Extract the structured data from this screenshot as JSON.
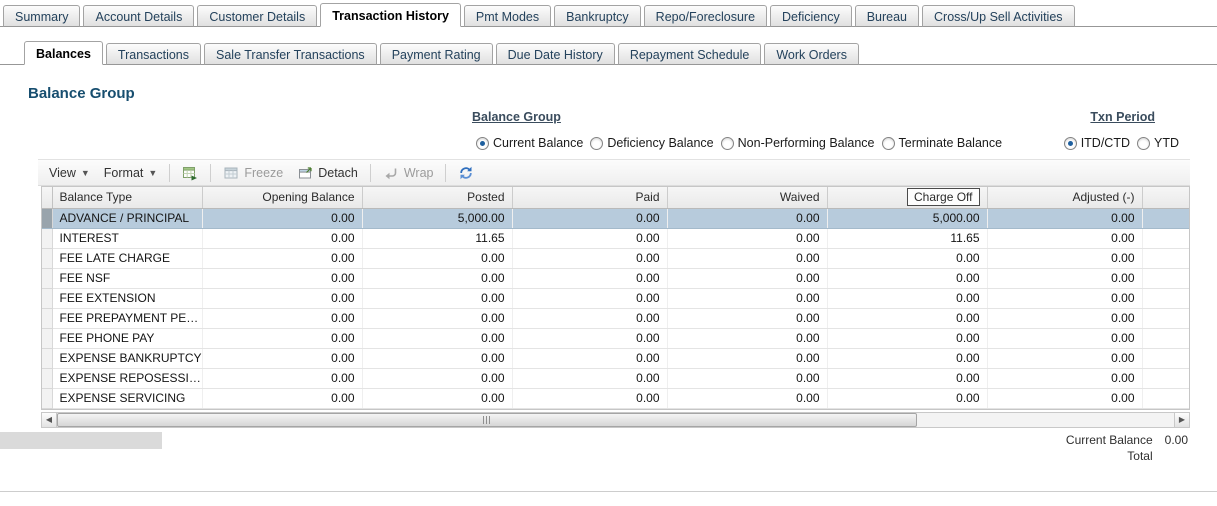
{
  "top_tabs": [
    {
      "label": "Summary",
      "active": false
    },
    {
      "label": "Account Details",
      "active": false
    },
    {
      "label": "Customer Details",
      "active": false
    },
    {
      "label": "Transaction History",
      "active": true
    },
    {
      "label": "Pmt Modes",
      "active": false
    },
    {
      "label": "Bankruptcy",
      "active": false
    },
    {
      "label": "Repo/Foreclosure",
      "active": false
    },
    {
      "label": "Deficiency",
      "active": false
    },
    {
      "label": "Bureau",
      "active": false
    },
    {
      "label": "Cross/Up Sell Activities",
      "active": false
    }
  ],
  "sub_tabs": [
    {
      "label": "Balances",
      "active": true
    },
    {
      "label": "Transactions",
      "active": false
    },
    {
      "label": "Sale Transfer Transactions",
      "active": false
    },
    {
      "label": "Payment Rating",
      "active": false
    },
    {
      "label": "Due Date History",
      "active": false
    },
    {
      "label": "Repayment Schedule",
      "active": false
    },
    {
      "label": "Work Orders",
      "active": false
    }
  ],
  "section": {
    "title": "Balance Group"
  },
  "filters": {
    "balance_group_label": "Balance Group",
    "txn_period_label": "Txn Period",
    "balance_group_options": [
      {
        "label": "Current Balance",
        "selected": true
      },
      {
        "label": "Deficiency Balance",
        "selected": false
      },
      {
        "label": "Non-Performing Balance",
        "selected": false
      },
      {
        "label": "Terminate Balance",
        "selected": false
      }
    ],
    "txn_period_options": [
      {
        "label": "ITD/CTD",
        "selected": true
      },
      {
        "label": "YTD",
        "selected": false
      }
    ]
  },
  "toolbar": {
    "view_label": "View",
    "format_label": "Format",
    "freeze_label": "Freeze",
    "detach_label": "Detach",
    "wrap_label": "Wrap",
    "icons": [
      "export-to-excel-icon",
      "freeze-icon",
      "detach-icon",
      "wrap-icon",
      "refresh-icon"
    ]
  },
  "table": {
    "columns": [
      "Balance Type",
      "Opening Balance",
      "Posted",
      "Paid",
      "Waived",
      "Charge Off",
      "Adjusted (-)"
    ],
    "focused_column": "Charge Off",
    "rows": [
      {
        "selected": true,
        "cells": [
          "ADVANCE / PRINCIPAL",
          "0.00",
          "5,000.00",
          "0.00",
          "0.00",
          "5,000.00",
          "0.00"
        ]
      },
      {
        "selected": false,
        "cells": [
          "INTEREST",
          "0.00",
          "11.65",
          "0.00",
          "0.00",
          "11.65",
          "0.00"
        ]
      },
      {
        "selected": false,
        "cells": [
          "FEE LATE CHARGE",
          "0.00",
          "0.00",
          "0.00",
          "0.00",
          "0.00",
          "0.00"
        ]
      },
      {
        "selected": false,
        "cells": [
          "FEE NSF",
          "0.00",
          "0.00",
          "0.00",
          "0.00",
          "0.00",
          "0.00"
        ]
      },
      {
        "selected": false,
        "cells": [
          "FEE EXTENSION",
          "0.00",
          "0.00",
          "0.00",
          "0.00",
          "0.00",
          "0.00"
        ]
      },
      {
        "selected": false,
        "cells": [
          "FEE PREPAYMENT PE…",
          "0.00",
          "0.00",
          "0.00",
          "0.00",
          "0.00",
          "0.00"
        ]
      },
      {
        "selected": false,
        "cells": [
          "FEE PHONE PAY",
          "0.00",
          "0.00",
          "0.00",
          "0.00",
          "0.00",
          "0.00"
        ]
      },
      {
        "selected": false,
        "cells": [
          "EXPENSE BANKRUPTCY",
          "0.00",
          "0.00",
          "0.00",
          "0.00",
          "0.00",
          "0.00"
        ]
      },
      {
        "selected": false,
        "cells": [
          "EXPENSE REPOSESSI…",
          "0.00",
          "0.00",
          "0.00",
          "0.00",
          "0.00",
          "0.00"
        ]
      },
      {
        "selected": false,
        "cells": [
          "EXPENSE SERVICING",
          "0.00",
          "0.00",
          "0.00",
          "0.00",
          "0.00",
          "0.00"
        ]
      }
    ]
  },
  "footer": {
    "total_label_line1": "Current Balance",
    "total_label_line2": "Total",
    "total_value": "0.00"
  }
}
